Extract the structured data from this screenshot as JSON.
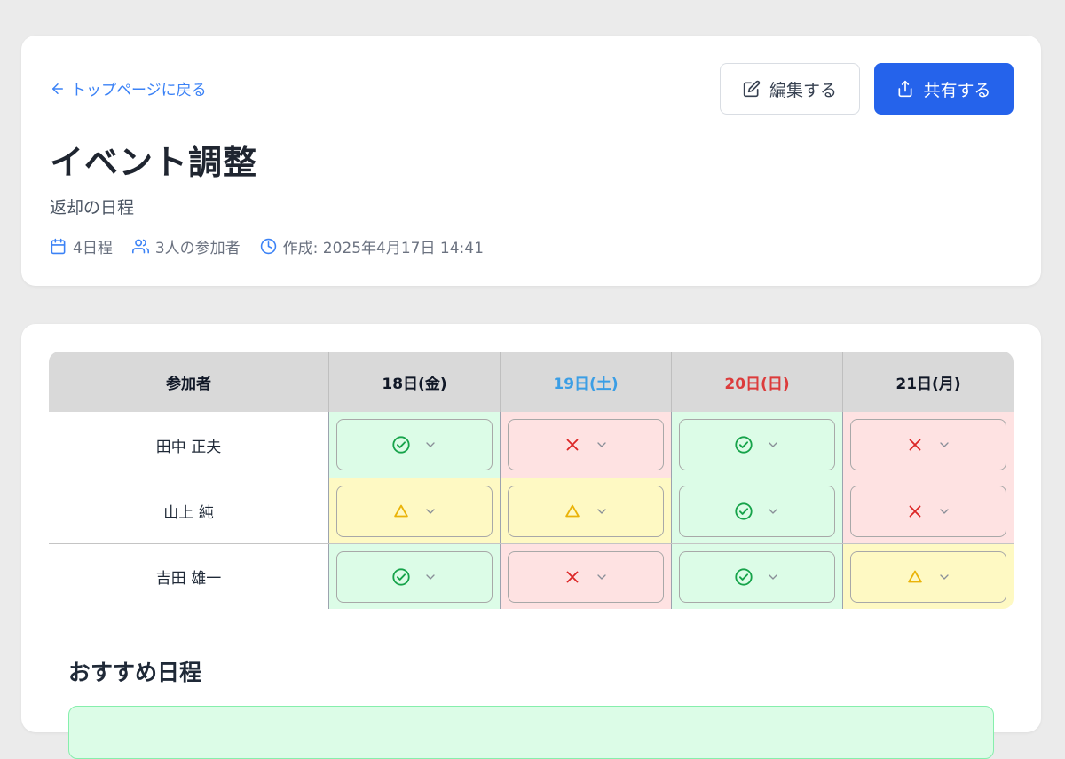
{
  "header": {
    "back_label": "トップページに戻る",
    "edit_label": "編集する",
    "share_label": "共有する",
    "title": "イベント調整",
    "subtitle": "返却の日程",
    "meta": {
      "dates_count": "4日程",
      "participants": "3人の参加者",
      "created": "作成: 2025年4月17日 14:41"
    }
  },
  "table": {
    "name_header": "参加者",
    "dates": [
      {
        "label": "18日(金)",
        "color": "#111827"
      },
      {
        "label": "19日(土)",
        "color": "#3b9ee5"
      },
      {
        "label": "20日(日)",
        "color": "#dc3b3b"
      },
      {
        "label": "21日(月)",
        "color": "#111827"
      }
    ],
    "rows": [
      {
        "name": "田中 正夫",
        "answers": [
          "ok",
          "ng",
          "ok",
          "ng"
        ]
      },
      {
        "name": "山上 純",
        "answers": [
          "maybe",
          "maybe",
          "ok",
          "ng"
        ]
      },
      {
        "name": "吉田 雄一",
        "answers": [
          "ok",
          "ng",
          "ok",
          "maybe"
        ]
      }
    ]
  },
  "recommend": {
    "title": "おすすめ日程"
  },
  "colors": {
    "accent": "#2563eb",
    "ok_mark": "#16a34a",
    "ng_mark": "#dc2626",
    "maybe_mark": "#eab308"
  },
  "icons": {
    "back": "arrow-left-icon",
    "edit": "edit-icon",
    "share": "share-icon",
    "calendar": "calendar-icon",
    "users": "users-icon",
    "clock": "clock-icon",
    "ok": "check-circle-icon",
    "ng": "x-icon",
    "maybe": "triangle-icon",
    "dropdown": "chevron-down-icon"
  }
}
